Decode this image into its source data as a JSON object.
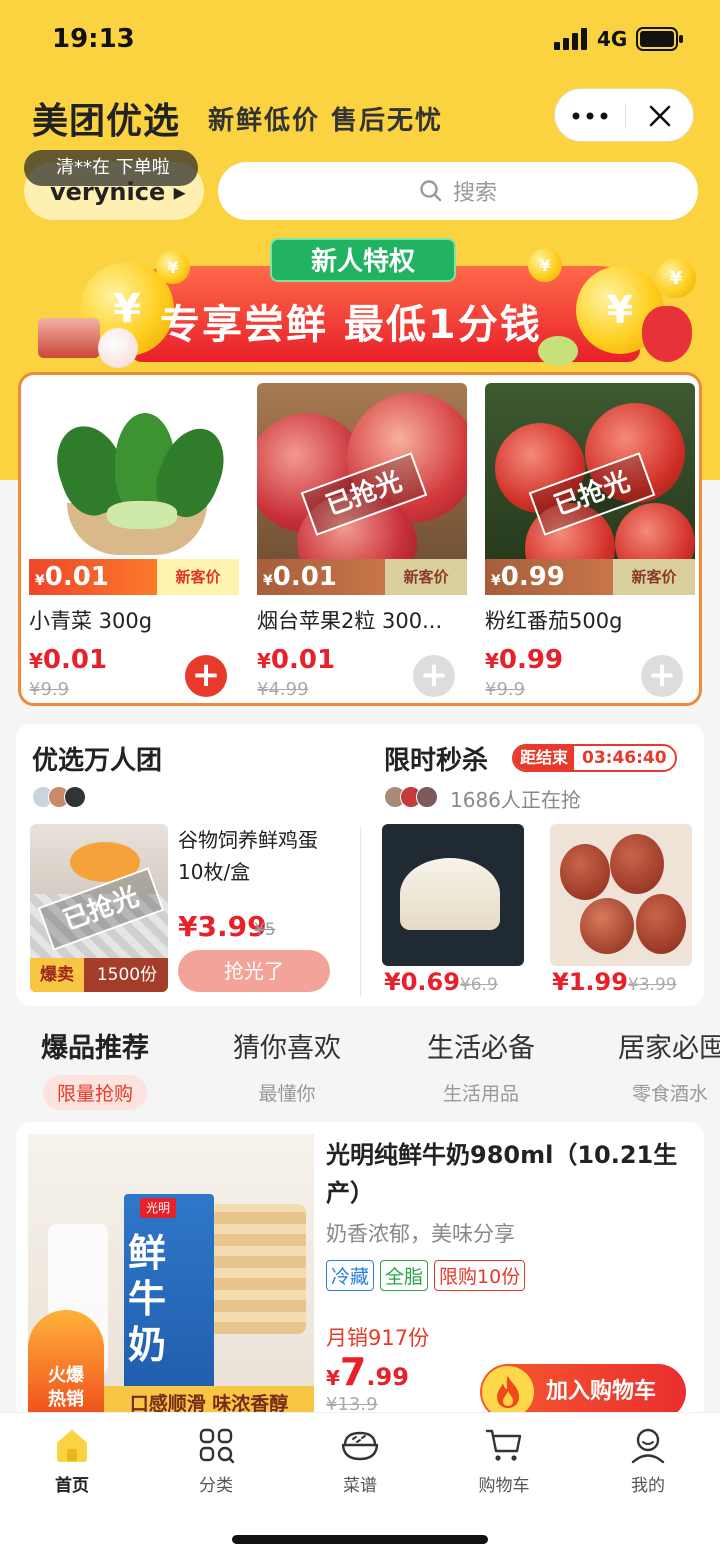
{
  "status": {
    "time": "19:13",
    "network": "4G"
  },
  "header": {
    "brand": "美团优选",
    "slogan": "新鲜低价 售后无忧"
  },
  "location": {
    "tip": "清**在 下单啦",
    "name": "verynice ▸"
  },
  "search": {
    "placeholder": "搜索"
  },
  "banner": {
    "tag": "新人特权",
    "text": "专享尝鲜 最低1分钱"
  },
  "new_user": {
    "items": [
      {
        "name": "小青菜 300g",
        "bar_price": "0.01",
        "bar_label": "新客价",
        "price": "0.01",
        "orig": "¥9.9",
        "sold_out": false
      },
      {
        "name": "烟台苹果2粒 300...",
        "bar_price": "0.01",
        "bar_label": "新客价",
        "price": "0.01",
        "orig": "¥4.99",
        "sold_out": true,
        "sold_label": "已抢光"
      },
      {
        "name": "粉红番茄500g",
        "bar_price": "0.99",
        "bar_label": "新客价",
        "price": "0.99",
        "orig": "¥9.9",
        "sold_out": true,
        "sold_label": "已抢光"
      }
    ],
    "currency": "¥"
  },
  "group_buy": {
    "title": "优选万人团",
    "product_name": "谷物饲养鲜鸡蛋10枚/盒",
    "sold_label": "已抢光",
    "hot_label": "爆卖",
    "hot_count": "1500份",
    "price": "¥3.99",
    "orig": "¥5",
    "button": "抢光了"
  },
  "flash_sale": {
    "title": "限时秒杀",
    "countdown_label": "距结束",
    "countdown": "03:46:40",
    "viewers": "1686人正在抢",
    "items": [
      {
        "price": "¥0.69",
        "orig": "¥6.9"
      },
      {
        "price": "¥1.99",
        "orig": "¥3.99"
      }
    ]
  },
  "tabs": [
    {
      "title": "爆品推荐",
      "sub": "限量抢购"
    },
    {
      "title": "猜你喜欢",
      "sub": "最懂你"
    },
    {
      "title": "生活必备",
      "sub": "生活用品"
    },
    {
      "title": "居家必囤",
      "sub": "零食酒水"
    }
  ],
  "product": {
    "name": "光明纯鲜牛奶980ml（10.21生产）",
    "desc": "奶香浓郁，美味分享",
    "tags": [
      "冷藏",
      "全脂",
      "限购10份"
    ],
    "sales": "月销917份",
    "price_symbol": "¥",
    "price_int": "7",
    "price_dec": ".99",
    "orig": "¥13.9",
    "button": "加入购物车",
    "badge": "火爆热销",
    "image_caption": "口感顺滑 味浓香醇",
    "brand_on_box": "光明",
    "box_text": "鲜牛奶"
  },
  "bottom_nav": [
    {
      "label": "首页"
    },
    {
      "label": "分类"
    },
    {
      "label": "菜谱"
    },
    {
      "label": "购物车"
    },
    {
      "label": "我的"
    }
  ],
  "colors": {
    "brand_yellow": "#fbd240",
    "accent_red": "#e8202a",
    "orange_border": "#f08a3a"
  }
}
